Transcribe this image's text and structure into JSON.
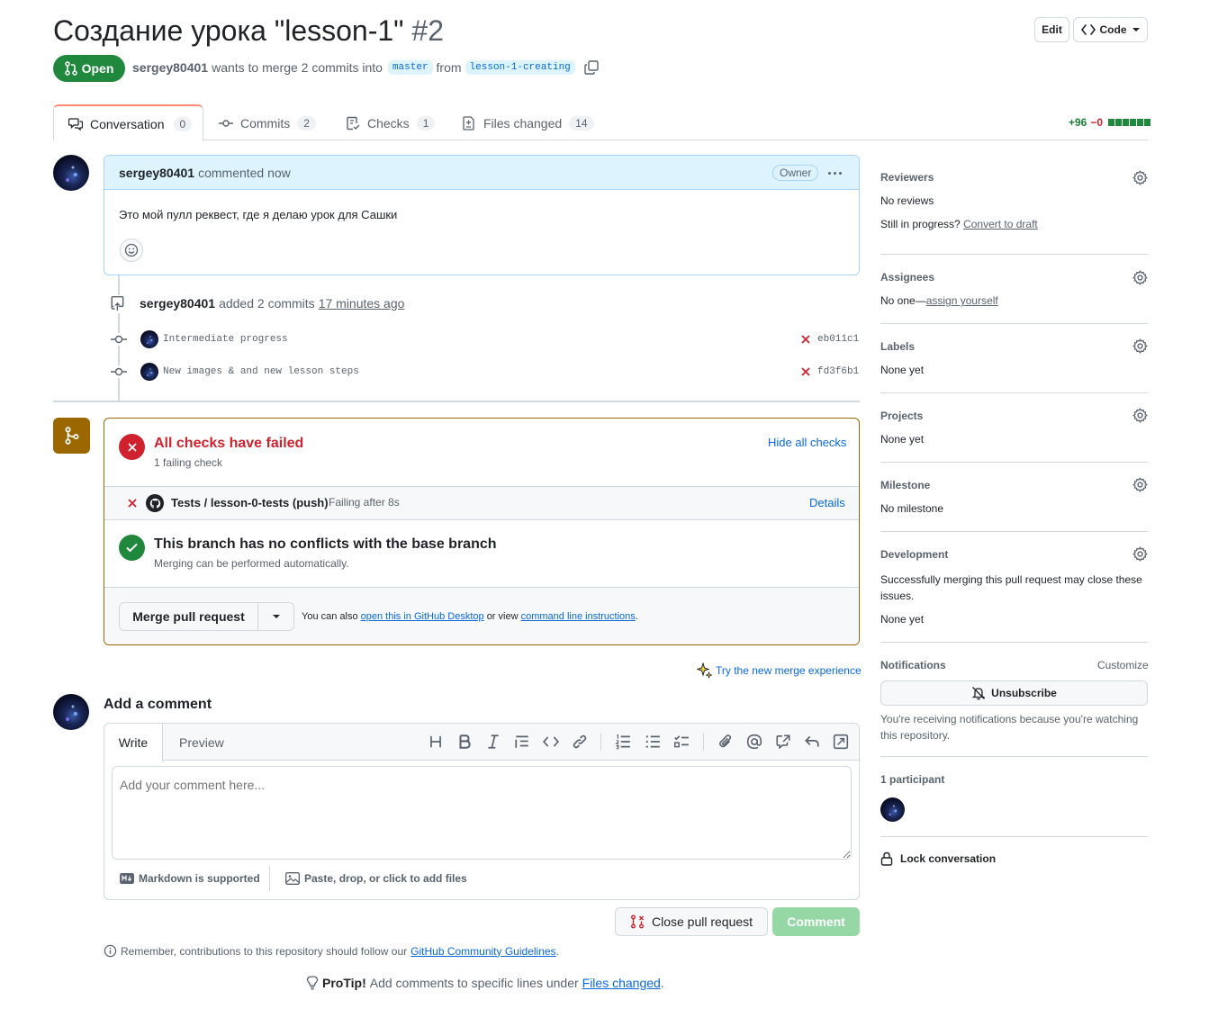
{
  "header": {
    "title": "Создание урока \"lesson-1\"",
    "number": "#2",
    "edit_label": "Edit",
    "code_label": "Code",
    "state": "Open",
    "author": "sergey80401",
    "merge_text": "wants to merge 2 commits into",
    "base_branch": "master",
    "from_text": "from",
    "head_branch": "lesson-1-creating"
  },
  "tabs": [
    {
      "label": "Conversation",
      "count": "0"
    },
    {
      "label": "Commits",
      "count": "2"
    },
    {
      "label": "Checks",
      "count": "1"
    },
    {
      "label": "Files changed",
      "count": "14"
    }
  ],
  "diffstat": {
    "additions": "+96",
    "deletions": "−0"
  },
  "comment": {
    "author": "sergey80401",
    "time": "commented now",
    "badge": "Owner",
    "body": "Это мой пулл реквест, где я делаю урок для Сашки"
  },
  "commits_event": {
    "author": "sergey80401",
    "text": "added 2 commits",
    "time": "17 minutes ago",
    "items": [
      {
        "message": "Intermediate progress",
        "sha": "eb011c1"
      },
      {
        "message": "New images & and new lesson steps",
        "sha": "fd3f6b1"
      }
    ]
  },
  "merge_box": {
    "checks_title": "All checks have failed",
    "checks_sub": "1 failing check",
    "hide_label": "Hide all checks",
    "check_name": "Tests / lesson-0-tests (push)",
    "check_status": "Failing after 8s",
    "details_label": "Details",
    "conflicts_title": "This branch has no conflicts with the base branch",
    "conflicts_sub": "Merging can be performed automatically.",
    "merge_button": "Merge pull request",
    "also_text": "You can also",
    "desktop_link": "open this in GitHub Desktop",
    "or_view": "or view",
    "cli_link": "command line instructions",
    "period": ".",
    "try_new": "Try the new merge experience"
  },
  "add_comment": {
    "title": "Add a comment",
    "write_tab": "Write",
    "preview_tab": "Preview",
    "placeholder": "Add your comment here...",
    "markdown": "Markdown is supported",
    "attach": "Paste, drop, or click to add files",
    "close_button": "Close pull request",
    "comment_button": "Comment"
  },
  "footer": {
    "remember": "Remember, contributions to this repository should follow our",
    "guidelines": "GitHub Community Guidelines",
    "period": ".",
    "protip_label": "ProTip!",
    "protip_text": "Add comments to specific lines under",
    "files_link": "Files changed",
    "protip_end": "."
  },
  "sidebar": {
    "reviewers_title": "Reviewers",
    "reviewers_value": "No reviews",
    "still_text": "Still in progress?",
    "convert_link": "Convert to draft",
    "assignees_title": "Assignees",
    "assignees_value": "No one—",
    "assign_link": "assign yourself",
    "labels_title": "Labels",
    "labels_value": "None yet",
    "projects_title": "Projects",
    "projects_value": "None yet",
    "milestone_title": "Milestone",
    "milestone_value": "No milestone",
    "development_title": "Development",
    "development_text": "Successfully merging this pull request may close these issues.",
    "development_value": "None yet",
    "notifications_title": "Notifications",
    "customize_label": "Customize",
    "unsubscribe_label": "Unsubscribe",
    "notify_text": "You're receiving notifications because you're watching this repository.",
    "participants_title": "1 participant",
    "lock_label": "Lock conversation"
  },
  "colors": {
    "open": "#1f883d",
    "link": "#0969da",
    "danger": "#cf222e",
    "attention": "#9a6700"
  }
}
